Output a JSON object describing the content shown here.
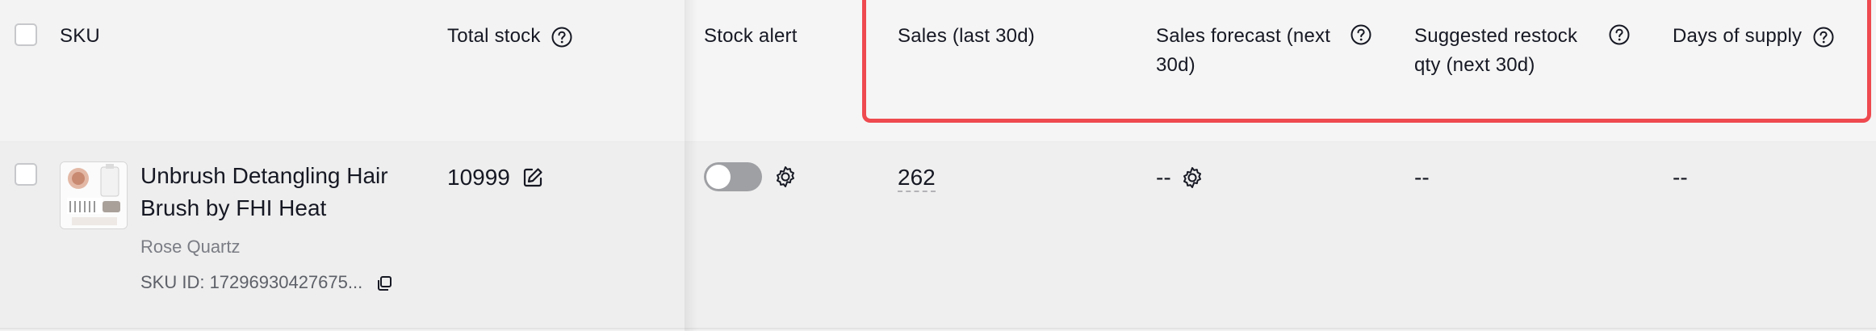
{
  "header": {
    "sku": "SKU",
    "total_stock": "Total stock",
    "stock_alert": "Stock alert",
    "sales_30d": "Sales (last 30d)",
    "sales_forecast_line1": "Sales forecast (next",
    "sales_forecast_line2": "30d)",
    "suggested_restock_line1": "Suggested restock",
    "suggested_restock_line2": "qty (next 30d)",
    "days_of_supply": "Days of supply"
  },
  "row": {
    "product_name": "Unbrush Detangling Hair Brush by FHI Heat",
    "variant": "Rose Quartz",
    "sku_id": "SKU ID: 17296930427675...",
    "total_stock": "10999",
    "stock_alert_enabled": false,
    "sales_30d": "262",
    "sales_forecast": "--",
    "suggested_restock": "--",
    "days_of_supply": "--"
  },
  "colors": {
    "highlight_border": "#ee4a4f",
    "toggle_off": "#9fa0a4"
  }
}
